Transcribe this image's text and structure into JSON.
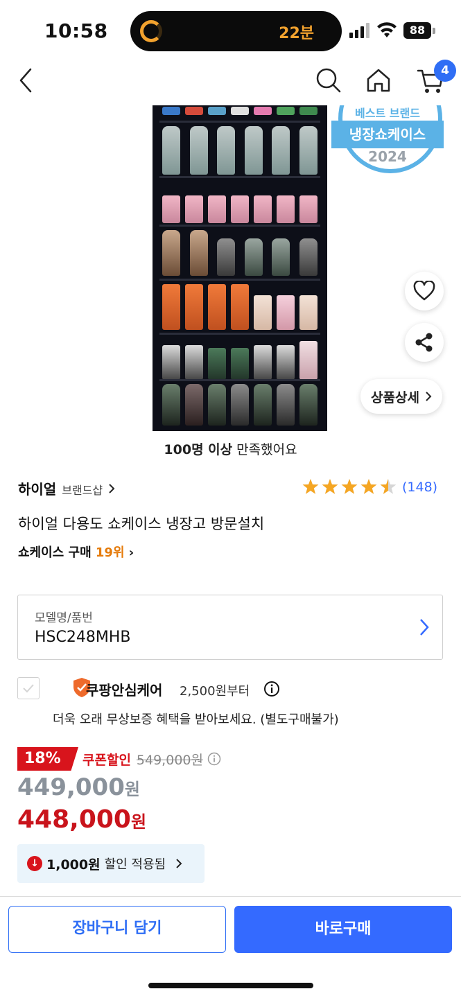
{
  "status_bar": {
    "time": "10:58",
    "activity_text": "22분",
    "battery": "88"
  },
  "nav": {
    "cart_count": "4"
  },
  "product_image": {
    "award_top": "베스트 브랜드",
    "award_ribbon": "냉장쇼케이스",
    "award_year": "2024"
  },
  "floating": {
    "detail_label": "상품상세"
  },
  "satisfaction": {
    "count": "100명 이상",
    "text": " 만족했어요"
  },
  "product": {
    "brand": "하이얼",
    "brand_shop": "브랜드샵",
    "rating": 4.5,
    "review_count": "(148)",
    "title": "하이얼 다용도 쇼케이스 냉장고 방문설치",
    "rank_label": "쇼케이스 구매 ",
    "rank_value": "19위",
    "rank_chevron": "›"
  },
  "model": {
    "label": "모델명/품번",
    "value": "HSC248MHB"
  },
  "care": {
    "title": "쿠팡안심케어",
    "price": "2,500원부터",
    "desc": "더욱 오래 무상보증 혜택을 받아보세요. (별도구매불가)"
  },
  "pricing": {
    "discount_pct": "18%",
    "coupon_label": "쿠폰할인",
    "original_price": "549,000원",
    "price_before_num": "449,000",
    "price_final_num": "448,000",
    "unit": "원",
    "applied_amount": "1,000원",
    "applied_text": "할인 적용됨"
  },
  "buttons": {
    "cart": "장바구니 담기",
    "buy": "바로구매"
  },
  "colors": {
    "accent": "#346aff",
    "sale_red": "#d8141c",
    "rank_orange": "#e57b0b",
    "star": "#f5a623"
  }
}
